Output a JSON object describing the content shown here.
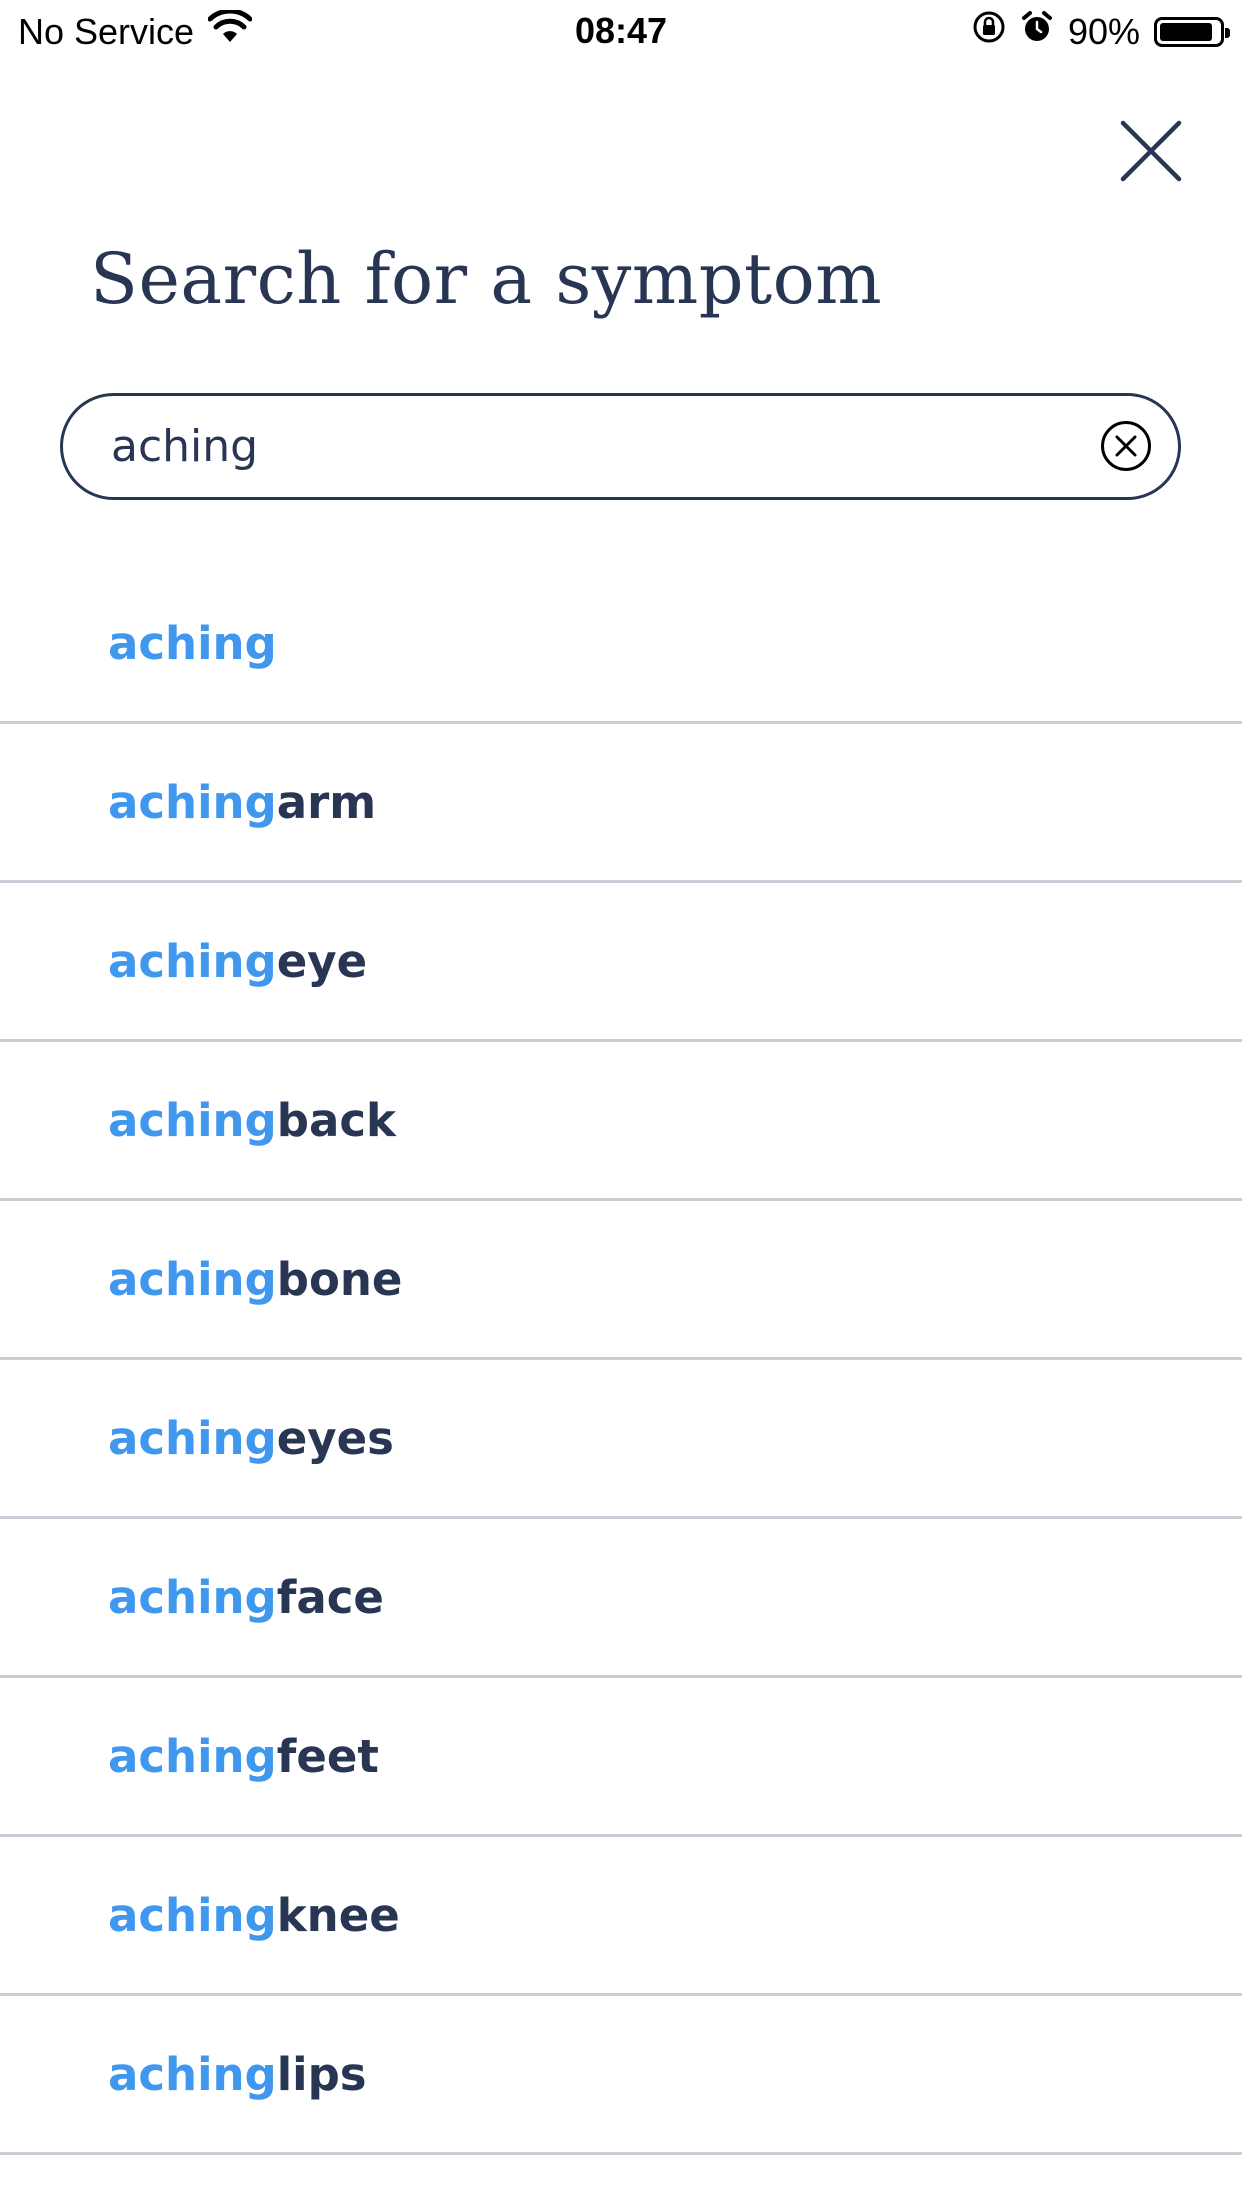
{
  "status_bar": {
    "carrier": "No Service",
    "time": "08:47",
    "battery_percent": "90%",
    "battery_level": 0.9
  },
  "header": {
    "title": "Search for a symptom"
  },
  "search": {
    "value": "aching",
    "placeholder": ""
  },
  "results": [
    {
      "match": "aching",
      "rest": ""
    },
    {
      "match": "aching",
      "rest": " arm"
    },
    {
      "match": "aching",
      "rest": " eye"
    },
    {
      "match": "aching",
      "rest": " back"
    },
    {
      "match": "aching",
      "rest": " bone"
    },
    {
      "match": "aching",
      "rest": " eyes"
    },
    {
      "match": "aching",
      "rest": " face"
    },
    {
      "match": "aching",
      "rest": " feet"
    },
    {
      "match": "aching",
      "rest": " knee"
    },
    {
      "match": "aching",
      "rest": " lips"
    }
  ],
  "colors": {
    "primary_text": "#283553",
    "match_highlight": "#3f97ee",
    "divider": "#c8cdd6"
  }
}
